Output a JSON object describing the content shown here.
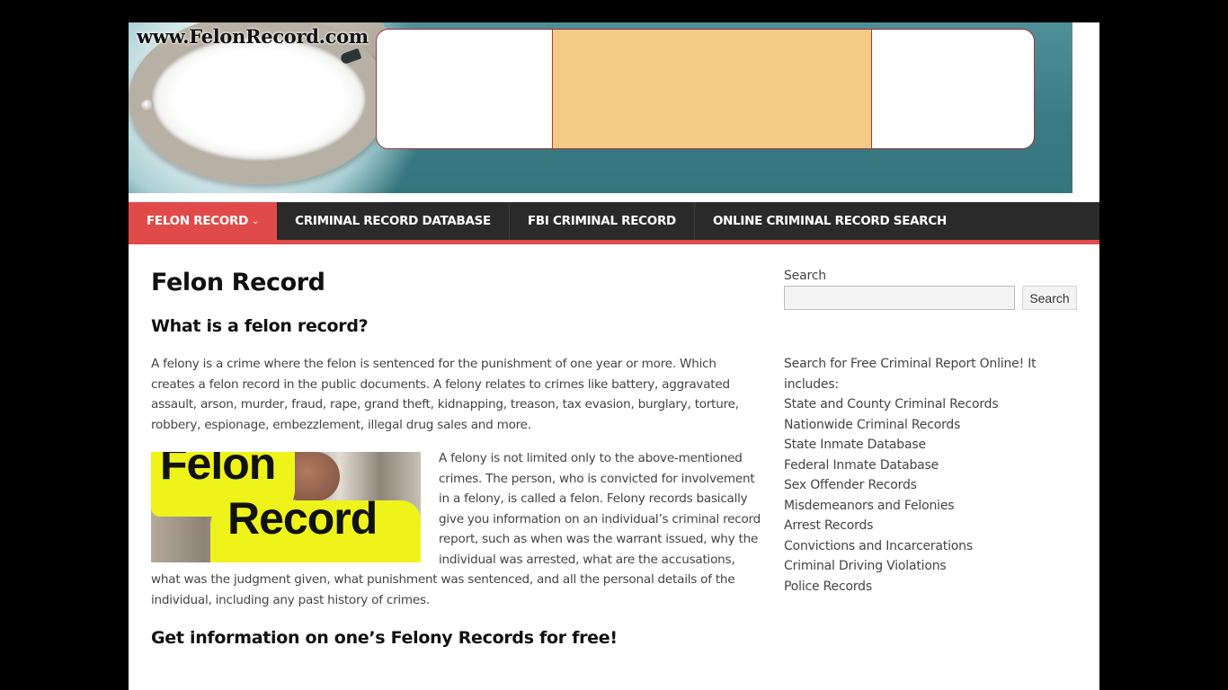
{
  "header": {
    "site_url": "www.FelonRecord.com",
    "colors": {
      "banner_teal": "#3a7a82",
      "ad_center": "#f5ca84",
      "ad_border": "#a0393a"
    }
  },
  "nav": {
    "items": [
      {
        "label": "FELON RECORD",
        "active": true,
        "has_dropdown": true
      },
      {
        "label": "CRIMINAL RECORD DATABASE",
        "active": false
      },
      {
        "label": "FBI CRIMINAL RECORD",
        "active": false
      },
      {
        "label": "ONLINE CRIMINAL RECORD SEARCH",
        "active": false
      }
    ],
    "dropdown_icon": "chevron-down-icon",
    "colors": {
      "background": "#2a2a2a",
      "accent": "#e04b4a"
    }
  },
  "main": {
    "title": "Felon Record",
    "section1_heading": "What is a felon record?",
    "paragraph1": "A felony is a crime where the felon is sentenced for the punishment of one year or more.  Which creates a felon record in the public documents. A felony relates to crimes like battery, aggravated assault, arson, murder, fraud, rape, grand theft, kidnapping, treason, tax evasion, burglary, torture, robbery, espionage, embezzlement, illegal drug sales and more.",
    "image": {
      "line1": "Felon",
      "line2": "Record",
      "alt": "Felon Record"
    },
    "paragraph2": "A felony is not limited only to the above-mentioned crimes. The person, who is convicted for involvement in a felony, is called a felon. Felony records basically give you information on an individual’s criminal record report, such as when was the warrant issued, why the individual was arrested, what are the accusations, what was the judgment given, what punishment was sentenced, and all the personal details of the individual, including any past history of crimes.",
    "section2_heading": "Get information on one’s Felony Records for free!"
  },
  "sidebar": {
    "search": {
      "label": "Search",
      "value": "",
      "placeholder": "",
      "button_label": "Search"
    },
    "intro": "Search for Free Criminal Report Online! It includes:",
    "items": [
      "State and County Criminal Records",
      "Nationwide Criminal Records",
      "State Inmate Database",
      "Federal Inmate Database",
      "Sex Offender Records",
      "Misdemeanors and Felonies",
      "Arrest Records",
      "Convictions and Incarcerations",
      "Criminal Driving Violations",
      "Police Records"
    ]
  }
}
